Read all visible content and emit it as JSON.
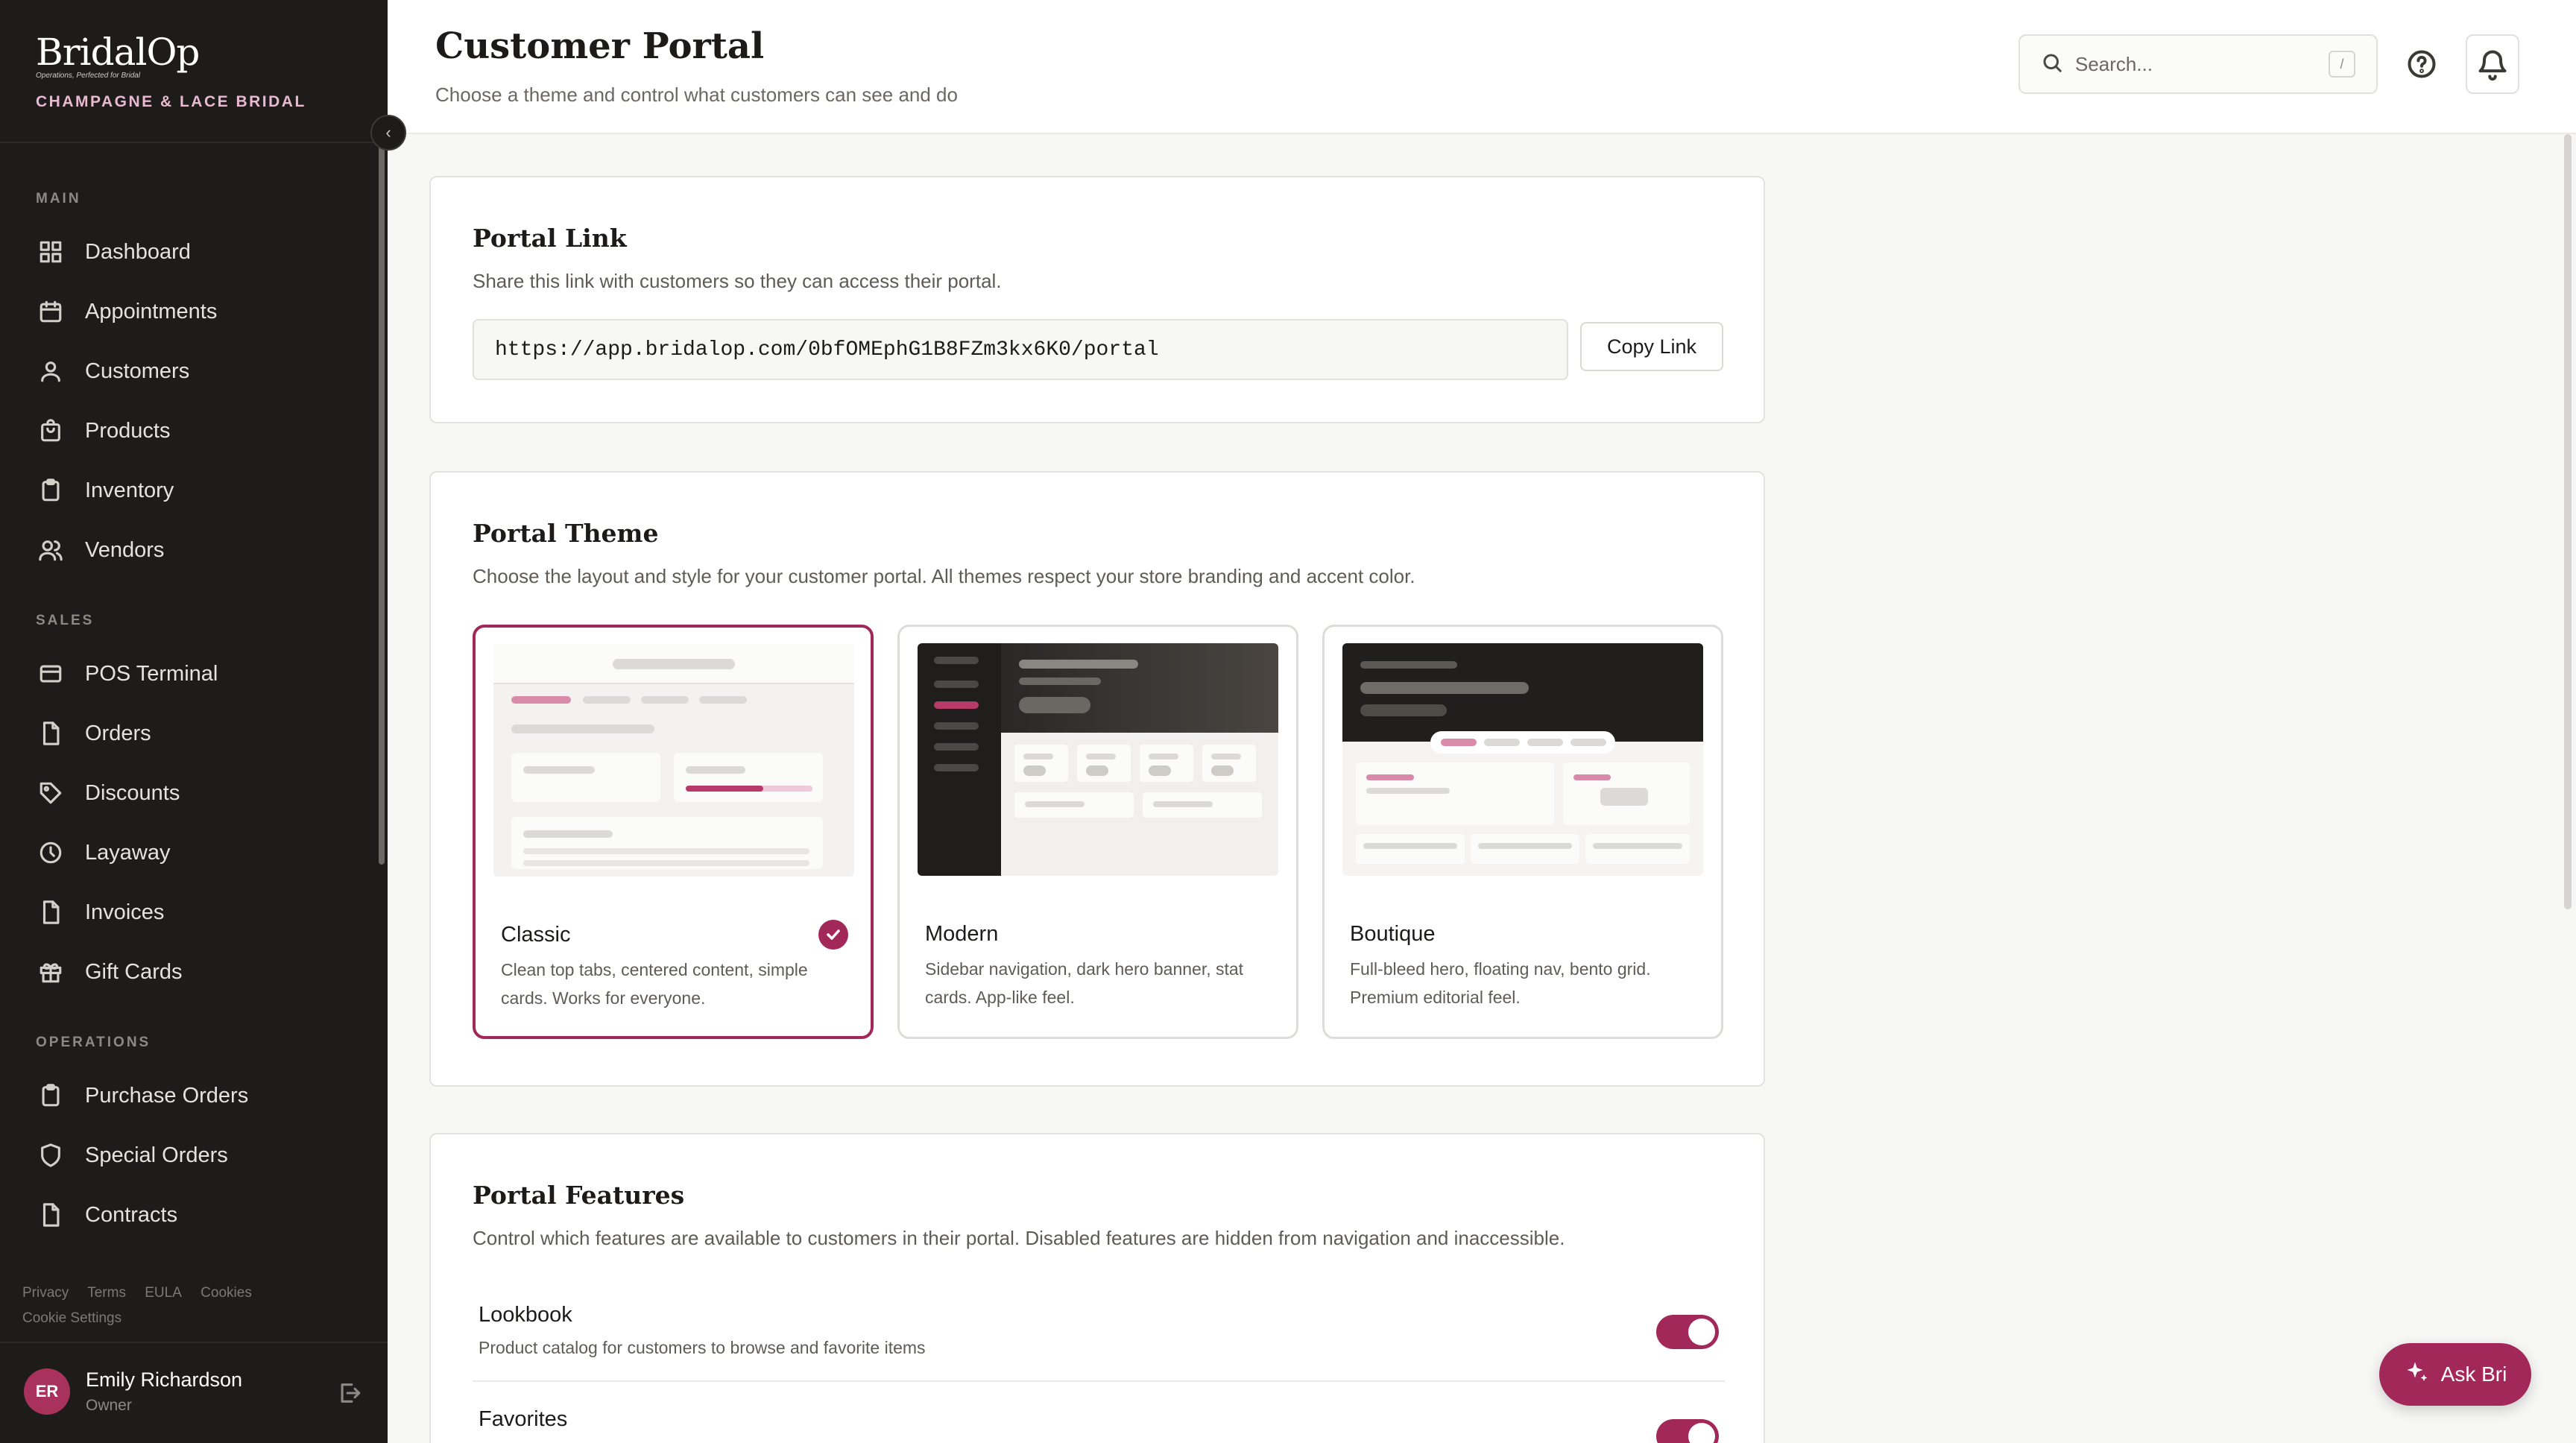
{
  "brand": {
    "logo": "BridalOp",
    "tagline": "Operations, Perfected for Bridal",
    "store": "CHAMPAGNE & LACE BRIDAL"
  },
  "nav": {
    "sections": [
      "MAIN",
      "SALES",
      "OPERATIONS"
    ],
    "main": [
      "Dashboard",
      "Appointments",
      "Customers",
      "Products",
      "Inventory",
      "Vendors"
    ],
    "sales": [
      "POS Terminal",
      "Orders",
      "Discounts",
      "Layaway",
      "Invoices",
      "Gift Cards"
    ],
    "operations": [
      "Purchase Orders",
      "Special Orders",
      "Contracts"
    ]
  },
  "legal": [
    "Privacy",
    "Terms",
    "EULA",
    "Cookies",
    "Cookie Settings"
  ],
  "user": {
    "initials": "ER",
    "name": "Emily Richardson",
    "role": "Owner"
  },
  "header": {
    "title": "Customer Portal",
    "subtitle": "Choose a theme and control what customers can see and do",
    "search_placeholder": "Search...",
    "search_shortcut": "/"
  },
  "portal_link": {
    "title": "Portal Link",
    "description": "Share this link with customers so they can access their portal.",
    "url": "https://app.bridalop.com/0bfOMEphG1B8FZm3kx6K0/portal",
    "copy_label": "Copy Link"
  },
  "portal_theme": {
    "title": "Portal Theme",
    "description": "Choose the layout and style for your customer portal. All themes respect your store branding and accent color.",
    "themes": [
      {
        "name": "Classic",
        "description": "Clean top tabs, centered content, simple cards. Works for everyone.",
        "selected": true
      },
      {
        "name": "Modern",
        "description": "Sidebar navigation, dark hero banner, stat cards. App-like feel.",
        "selected": false
      },
      {
        "name": "Boutique",
        "description": "Full-bleed hero, floating nav, bento grid. Premium editorial feel.",
        "selected": false
      }
    ]
  },
  "portal_features": {
    "title": "Portal Features",
    "description": "Control which features are available to customers in their portal. Disabled features are hidden from navigation and inaccessible.",
    "items": [
      {
        "name": "Lookbook",
        "description": "Product catalog for customers to browse and favorite items",
        "enabled": true
      },
      {
        "name": "Favorites",
        "description": "",
        "enabled": true
      }
    ]
  },
  "assistant": {
    "label": "Ask Bri"
  },
  "colors": {
    "accent": "#a3285a",
    "sidebar": "#1d1c1b",
    "brand_pink": "#e9b9cf"
  }
}
